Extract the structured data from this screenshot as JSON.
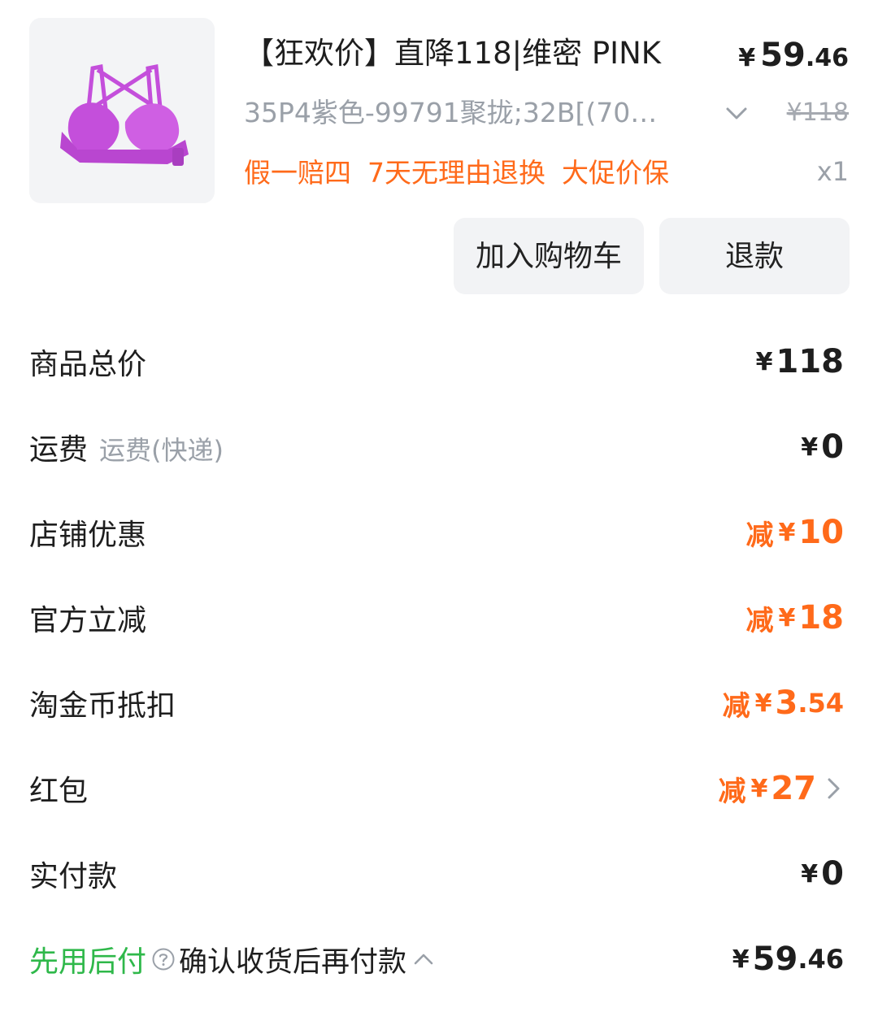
{
  "product": {
    "title": "【狂欢价】直降118|维密 PINK",
    "spec": "35P4紫色-99791聚拢;32B[(70…",
    "price_now": {
      "currency": "¥",
      "integer": "59",
      "decimal": ".46"
    },
    "price_original": "¥118",
    "tags": [
      "假一赔四",
      "7天无理由退换",
      "大促价保"
    ],
    "quantity": "x1",
    "image_color": "#c44fdb"
  },
  "actions": {
    "add_cart": "加入购物车",
    "refund": "退款"
  },
  "summary": {
    "total": {
      "label": "商品总价",
      "currency": "¥",
      "value": "118"
    },
    "shipping": {
      "label": "运费",
      "sub": "运费(快递)",
      "currency": "¥",
      "value": "0"
    },
    "store_discount": {
      "label": "店铺优惠",
      "prefix": "减",
      "currency": "¥",
      "value": "10"
    },
    "official_discount": {
      "label": "官方立减",
      "prefix": "减",
      "currency": "¥",
      "value": "18"
    },
    "coins": {
      "label": "淘金币抵扣",
      "prefix": "减",
      "currency": "¥",
      "integer": "3",
      "decimal": ".54"
    },
    "red_packet": {
      "label": "红包",
      "prefix": "减",
      "currency": "¥",
      "value": "27"
    },
    "paid": {
      "label": "实付款",
      "currency": "¥",
      "value": "0"
    },
    "bnpl": {
      "title": "先用后付",
      "desc": "确认收货后再付款",
      "currency": "¥",
      "integer": "59",
      "decimal": ".46"
    }
  },
  "colors": {
    "accent_orange": "#ff6a1a",
    "bnpl_green": "#2fb84a",
    "muted_gray": "#9aa0a8"
  }
}
